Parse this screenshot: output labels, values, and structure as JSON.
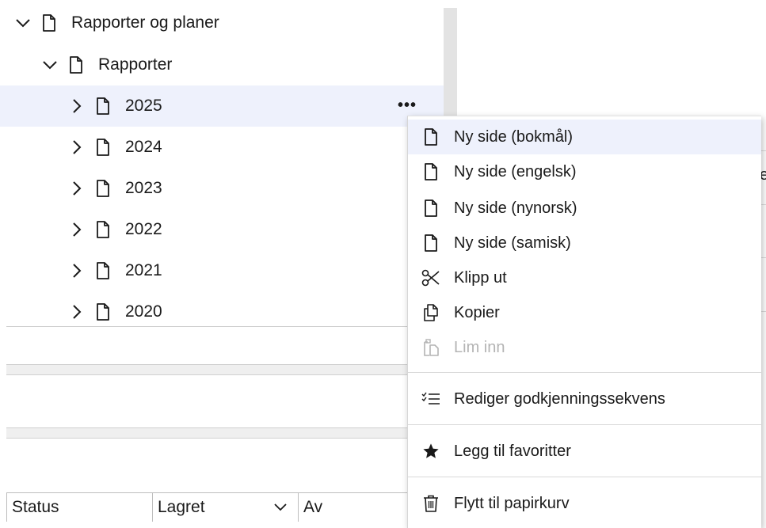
{
  "tree": {
    "root": {
      "label": "Rapporter og planer",
      "expanded": true
    },
    "child": {
      "label": "Rapporter",
      "expanded": true
    },
    "years": [
      {
        "label": "2025",
        "selected": true
      },
      {
        "label": "2024",
        "selected": false
      },
      {
        "label": "2023",
        "selected": false
      },
      {
        "label": "2022",
        "selected": false
      },
      {
        "label": "2021",
        "selected": false
      },
      {
        "label": "2020",
        "selected": false
      }
    ],
    "more_actions": "•••"
  },
  "columns": {
    "status": "Status",
    "lagret": "Lagret",
    "av": "Av"
  },
  "edge_text": "e",
  "context_menu": {
    "items": [
      {
        "label": "Ny side (bokmål)",
        "icon": "document-icon",
        "state": "hover"
      },
      {
        "label": "Ny side (engelsk)",
        "icon": "document-icon",
        "state": "normal"
      },
      {
        "label": "Ny side (nynorsk)",
        "icon": "document-icon",
        "state": "normal"
      },
      {
        "label": "Ny side (samisk)",
        "icon": "document-icon",
        "state": "normal"
      },
      {
        "label": "Klipp ut",
        "icon": "scissors-icon",
        "state": "normal"
      },
      {
        "label": "Kopier",
        "icon": "copy-icon",
        "state": "normal"
      },
      {
        "label": "Lim inn",
        "icon": "paste-icon",
        "state": "disabled"
      },
      {
        "label": "Rediger godkjenningssekvens",
        "icon": "checklist-icon",
        "state": "normal"
      },
      {
        "label": "Legg til favoritter",
        "icon": "star-icon",
        "state": "normal"
      },
      {
        "label": "Flytt til papirkurv",
        "icon": "trash-icon",
        "state": "normal"
      }
    ]
  },
  "colors": {
    "selected_bg": "#eef1fc",
    "disabled_text": "#b4b4b4",
    "text": "#1a1a1a"
  }
}
